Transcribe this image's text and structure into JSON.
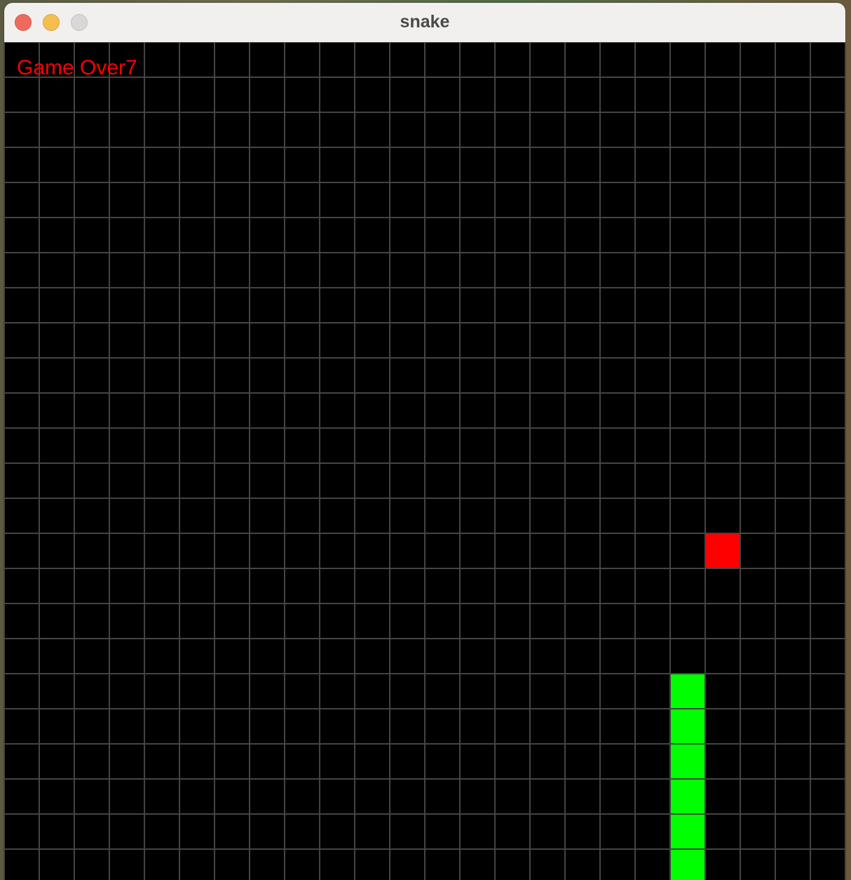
{
  "window": {
    "title": "snake"
  },
  "game": {
    "status_text": "Game Over",
    "score": "7",
    "grid": {
      "columns": 24,
      "visible_rows": 24
    },
    "food": {
      "col": 20,
      "row": 14,
      "color": "#ff0000"
    },
    "snake": {
      "color": "#00ff00",
      "segments": [
        {
          "col": 19,
          "row": 18
        },
        {
          "col": 19,
          "row": 19
        },
        {
          "col": 19,
          "row": 20
        },
        {
          "col": 19,
          "row": 21
        },
        {
          "col": 19,
          "row": 22
        },
        {
          "col": 19,
          "row": 23
        }
      ]
    },
    "colors": {
      "background": "#000000",
      "grid_line": "#444444",
      "text": "#ff0000"
    }
  }
}
